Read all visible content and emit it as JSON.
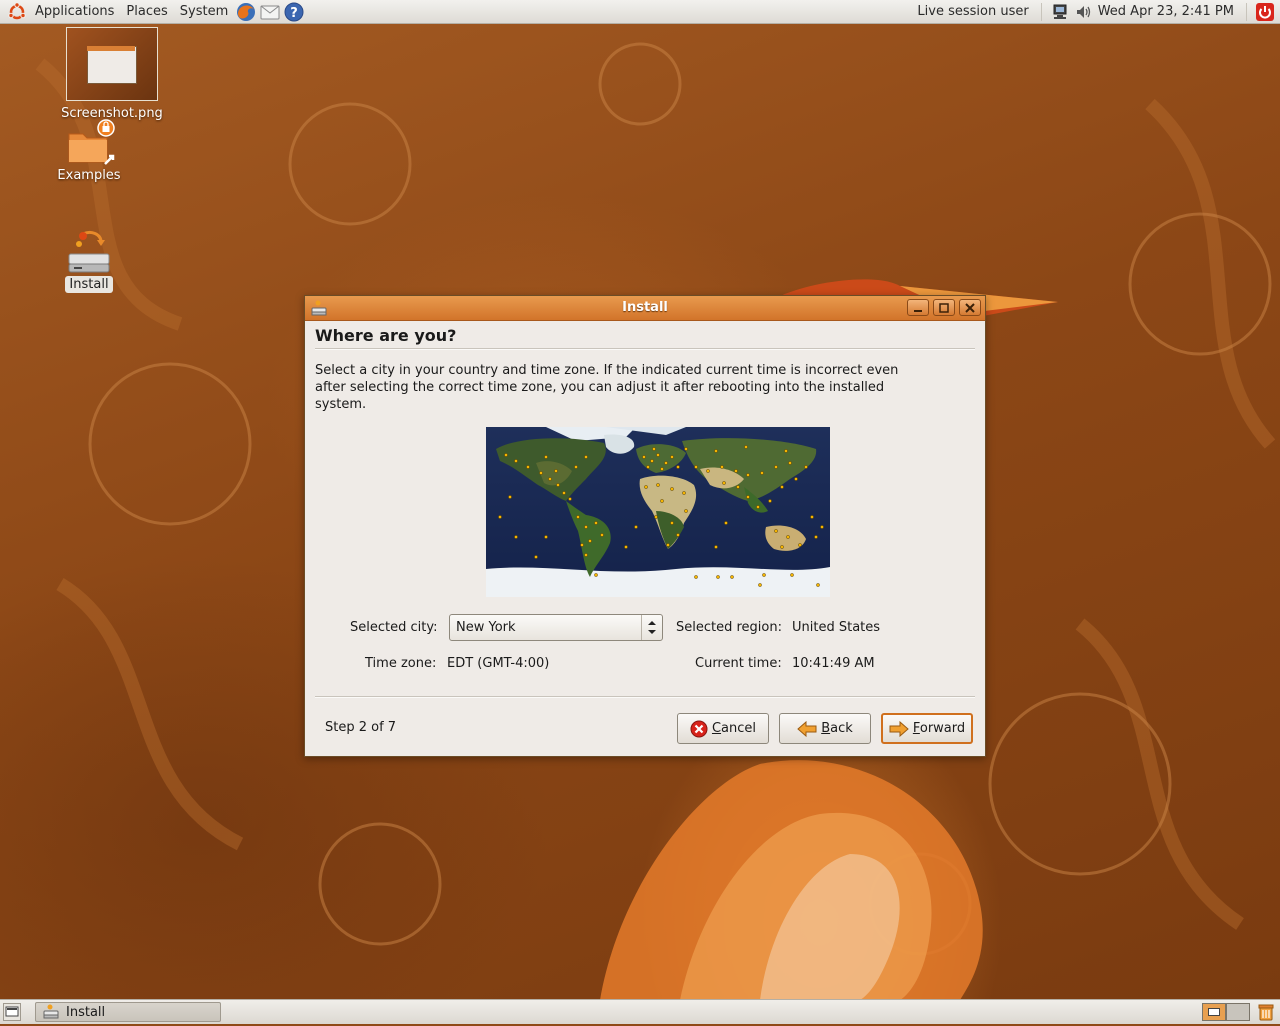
{
  "top_panel": {
    "menus": [
      "Applications",
      "Places",
      "System"
    ],
    "session_user": "Live session user",
    "clock": "Wed Apr 23,  2:41 PM"
  },
  "desktop": {
    "icons": [
      {
        "label": "Screenshot.png"
      },
      {
        "label": "Examples"
      },
      {
        "label": "Install"
      }
    ]
  },
  "window": {
    "title": "Install",
    "heading": "Where are you?",
    "intro": "Select a city in your country and time zone. If the indicated current time is incorrect even after selecting the correct time zone, you can adjust it after rebooting into the installed system.",
    "selected_city_label": "Selected city:",
    "selected_city_value": "New York",
    "selected_region_label": "Selected region:",
    "selected_region_value": "United States",
    "time_zone_label": "Time zone:",
    "time_zone_value": "EDT (GMT-4:00)",
    "current_time_label": "Current time:",
    "current_time_value": "10:41:49 AM",
    "step": "Step 2 of 7",
    "buttons": {
      "cancel_mnemonic": "C",
      "cancel_rest": "ancel",
      "back_mnemonic": "B",
      "back_rest": "ack",
      "forward_mnemonic": "F",
      "forward_rest": "orward"
    }
  },
  "bottom_panel": {
    "task_label": "Install"
  },
  "colors": {
    "titlebar": "#d97f34",
    "window_bg": "#efebe7",
    "accent": "#d0701e",
    "wallpaper": "#8f4a17"
  }
}
